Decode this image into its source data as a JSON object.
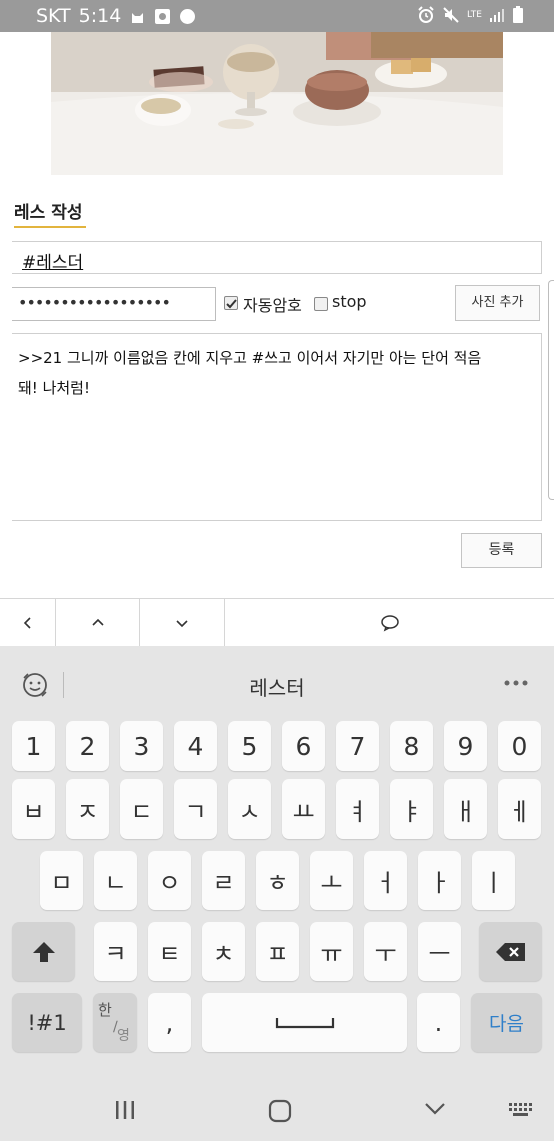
{
  "status_bar": {
    "carrier": "SKT",
    "time": "5:14",
    "network": "LTE"
  },
  "form": {
    "section_title": "레스 작성",
    "name_value": "#레스더",
    "password_masked": "••••••••••••••••••",
    "auto_password_label": "자동암호",
    "auto_password_checked": true,
    "stop_label": "stop",
    "stop_checked": false,
    "add_photo_label": "사진 추가",
    "content_line1": ">>21  그니까 이름없음 칸에 지우고 #쓰고 이어서 자기만 아는 단어 적음",
    "content_line2": "돼! 나처럼!",
    "submit_label": "등록"
  },
  "nav_icons": [
    "back-icon",
    "chevron-up-icon",
    "chevron-down-icon",
    "comment-icon"
  ],
  "keyboard": {
    "suggestion": "레스터",
    "numbers": [
      "1",
      "2",
      "3",
      "4",
      "5",
      "6",
      "7",
      "8",
      "9",
      "0"
    ],
    "row1": [
      "ㅂ",
      "ㅈ",
      "ㄷ",
      "ㄱ",
      "ㅅ",
      "ㅛ",
      "ㅕ",
      "ㅑ",
      "ㅐ",
      "ㅔ"
    ],
    "row2": [
      "ㅁ",
      "ㄴ",
      "ㅇ",
      "ㄹ",
      "ㅎ",
      "ㅗ",
      "ㅓ",
      "ㅏ",
      "ㅣ"
    ],
    "row3": [
      "ㅋ",
      "ㅌ",
      "ㅊ",
      "ㅍ",
      "ㅠ",
      "ㅜ",
      "ㅡ"
    ],
    "symbols_label": "!#1",
    "lang_top": "한",
    "lang_bottom": "영",
    "comma": ",",
    "period": ".",
    "enter_label": "다음"
  },
  "colors": {
    "accent_underline": "#e2b43d",
    "status_bar": "#9a9a9a",
    "keyboard_bg": "#e5e5e5",
    "enter_text": "#2f7fc9"
  }
}
